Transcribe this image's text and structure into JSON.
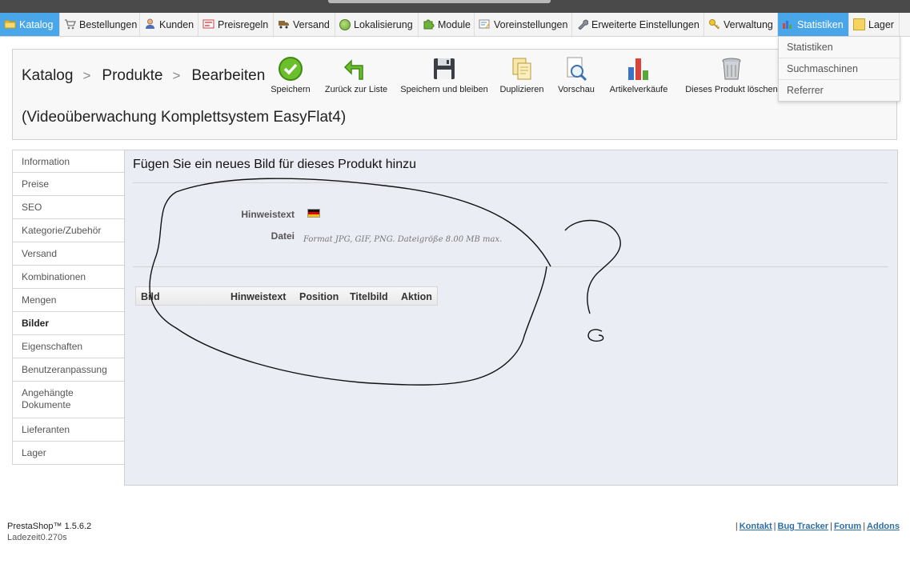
{
  "menu": {
    "items": [
      {
        "label": "Katalog",
        "icon": "folder-icon",
        "active": true
      },
      {
        "label": "Bestellungen",
        "icon": "cart-icon"
      },
      {
        "label": "Kunden",
        "icon": "user-icon"
      },
      {
        "label": "Preisregeln",
        "icon": "price-tag-icon"
      },
      {
        "label": "Versand",
        "icon": "truck-icon"
      },
      {
        "label": "Lokalisierung",
        "icon": "globe-icon"
      },
      {
        "label": "Module",
        "icon": "puzzle-icon"
      },
      {
        "label": "Voreinstellungen",
        "icon": "form-icon"
      },
      {
        "label": "Erweiterte Einstellungen",
        "icon": "wrench-icon"
      },
      {
        "label": "Verwaltung",
        "icon": "key-icon"
      },
      {
        "label": "Statistiken",
        "icon": "stats-icon",
        "highlight": true
      },
      {
        "label": "Lager",
        "icon": "box-icon"
      }
    ],
    "active_color": "#49a6e8"
  },
  "dropdown": {
    "items": [
      "Statistiken",
      "Suchmaschinen",
      "Referrer"
    ]
  },
  "header": {
    "breadcrumb": [
      "Katalog",
      "Produkte",
      "Bearbeiten"
    ],
    "separator": ">",
    "product_name": "(Videoüberwachung Komplettsystem EasyFlat4)"
  },
  "toolbar": {
    "save": "Speichern",
    "back": "Zurück zur Liste",
    "save_stay": "Speichern und bleiben",
    "duplicate": "Duplizieren",
    "preview": "Vorschau",
    "sales": "Artikelverkäufe",
    "delete": "Dieses Produkt löschen"
  },
  "tabs": [
    "Information",
    "Preise",
    "SEO",
    "Kategorie/Zubehör",
    "Versand",
    "Kombinationen",
    "Mengen",
    "Bilder",
    "Eigenschaften",
    "Benutzeranpassung",
    "Angehängte Dokumente",
    "Lieferanten",
    "Lager"
  ],
  "active_tab": "Bilder",
  "content": {
    "title": "Fügen Sie ein neues Bild für dieses Produkt hinzu",
    "caption_label": "Hinweistext",
    "file_label": "Datei",
    "file_hint": "Format JPG, GIF, PNG. Dateigröße 8.00 MB max.",
    "table_headers": [
      "Bild",
      "Hinweistext",
      "Position",
      "Titelbild",
      "Aktion"
    ]
  },
  "footer": {
    "version": "PrestaShop™ 1.5.6.2",
    "load_time": "Ladezeit0.270s",
    "links": [
      "Kontakt",
      "Bug Tracker",
      "Forum",
      "Addons"
    ],
    "separator": "|"
  }
}
